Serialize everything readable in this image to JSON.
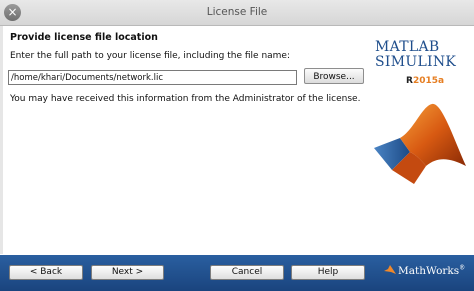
{
  "window": {
    "title": "License File",
    "close_glyph": "×"
  },
  "main": {
    "heading": "Provide license file location",
    "instruction": "Enter the full path to your license file, including the file name:",
    "license_path": "/home/khari/Documents/network.lic",
    "browse_label": "Browse...",
    "info_text": "You may have received this information from the Administrator of the license."
  },
  "branding": {
    "product_line1": "MATLAB",
    "product_line2": "SIMULINK",
    "release_prefix": "R",
    "release_version": "2015a",
    "vendor": "MathWorks",
    "vendor_mark": "®",
    "accent_blue": "#1f4e8c",
    "accent_orange": "#e67e22"
  },
  "footer": {
    "back_label": "< Back",
    "next_label": "Next >",
    "cancel_label": "Cancel",
    "help_label": "Help",
    "bar_color": "#1f4e8c"
  }
}
